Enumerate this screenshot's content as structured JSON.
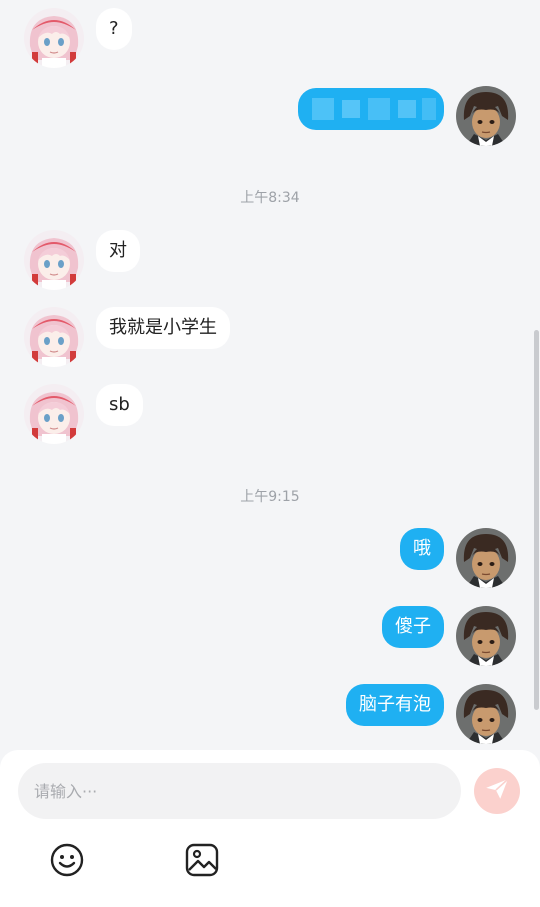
{
  "messages": {
    "m1_text": "?",
    "time1": "上午8:34",
    "m3_text": "对",
    "m4_text": "我就是小学生",
    "m5_text": "sb",
    "time2": "上午9:15",
    "m6_text": "哦",
    "m7_text": "傻子",
    "m8_text": "脑子有泡"
  },
  "composer": {
    "placeholder": "请输入···"
  },
  "icons": {
    "send": "send-icon",
    "emoji": "emoji-icon",
    "image": "image-icon"
  },
  "colors": {
    "outgoing_bubble": "#1fb0f2",
    "incoming_bubble": "#ffffff",
    "send_button": "#fbd1cd"
  }
}
